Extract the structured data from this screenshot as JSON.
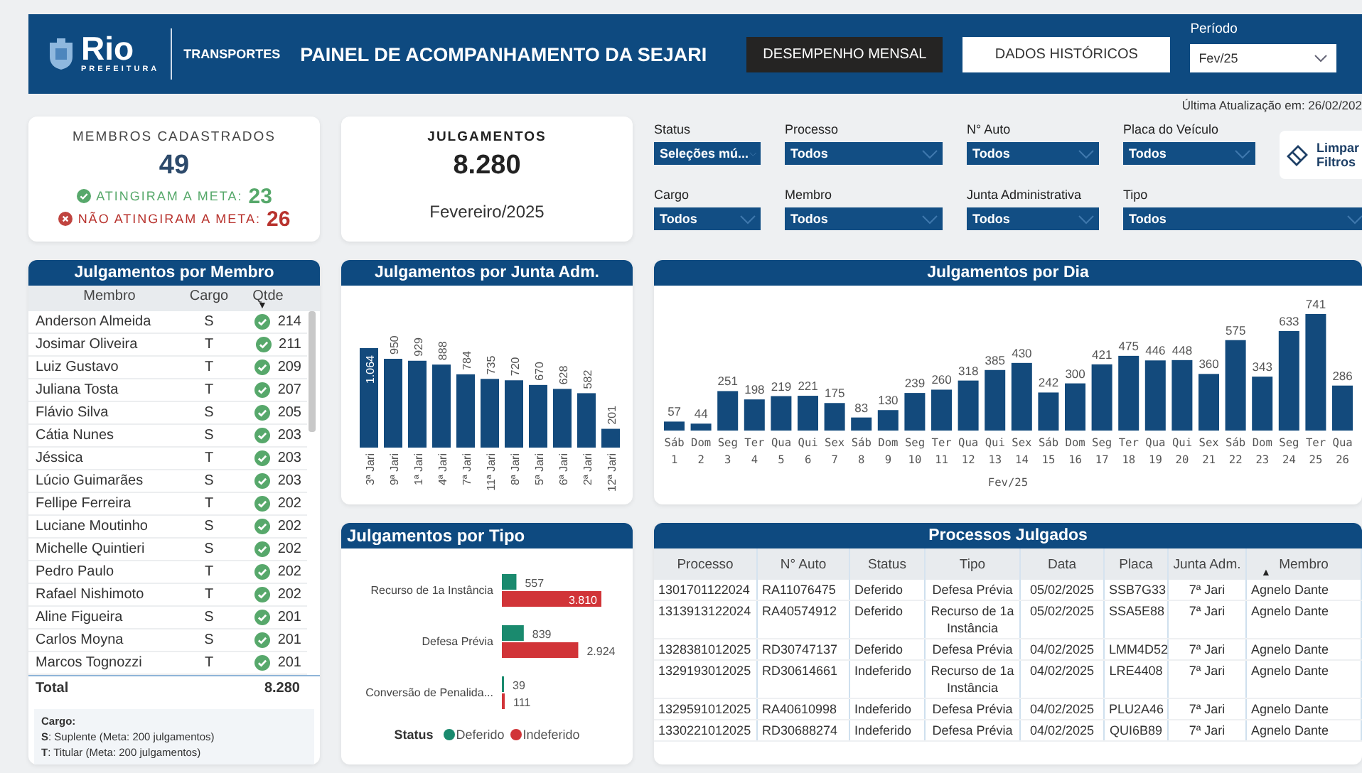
{
  "header": {
    "logo_text": "Rio",
    "logo_subtext": "PREFEITURA",
    "section": "TRANSPORTES",
    "title": "PAINEL DE ACOMPANHAMENTO DA SEJARI",
    "tabs": [
      {
        "label": "DESEMPENHO MENSAL",
        "selected": true
      },
      {
        "label": "DADOS HISTÓRICOS",
        "selected": false
      }
    ],
    "period": {
      "label": "Período",
      "value": "Fev/25"
    }
  },
  "last_update": "Última Atualização em: 26/02/202",
  "members_card": {
    "title": "MEMBROS CADASTRADOS",
    "value": "49",
    "met_label": "ATINGIRAM A META:",
    "met_value": "23",
    "not_met_label": "NÃO ATINGIRAM A META:",
    "not_met_value": "26"
  },
  "judgments_card": {
    "title": "JULGAMENTOS",
    "value": "8.280",
    "period": "Fevereiro/2025"
  },
  "filters": [
    {
      "label": "Status",
      "value": "Seleções mú..."
    },
    {
      "label": "Processo",
      "value": "Todos"
    },
    {
      "label": "N° Auto",
      "value": "Todos"
    },
    {
      "label": "Placa do Veículo",
      "value": "Todos"
    },
    {
      "label": "Cargo",
      "value": "Todos"
    },
    {
      "label": "Membro",
      "value": "Todos"
    },
    {
      "label": "Junta Administrativa",
      "value": "Todos"
    },
    {
      "label": "Tipo",
      "value": "Todos"
    }
  ],
  "clear_filters": "Limpar Filtros",
  "members_table": {
    "title": "Julgamentos por Membro",
    "columns": [
      {
        "label": "Membro"
      },
      {
        "label": "Cargo"
      },
      {
        "label": "Qtde",
        "sort_icon": "▼"
      }
    ],
    "rows": [
      {
        "name": "Anderson Almeida",
        "cargo": "S",
        "qtde": "214",
        "met": true
      },
      {
        "name": "Josimar Oliveira",
        "cargo": "T",
        "qtde": "211",
        "met": true
      },
      {
        "name": "Luiz Gustavo",
        "cargo": "T",
        "qtde": "209",
        "met": true
      },
      {
        "name": "Juliana Tosta",
        "cargo": "T",
        "qtde": "207",
        "met": true
      },
      {
        "name": "Flávio Silva",
        "cargo": "S",
        "qtde": "205",
        "met": true
      },
      {
        "name": "Cátia Nunes",
        "cargo": "S",
        "qtde": "203",
        "met": true
      },
      {
        "name": "Jéssica",
        "cargo": "T",
        "qtde": "203",
        "met": true
      },
      {
        "name": "Lúcio Guimarães",
        "cargo": "S",
        "qtde": "203",
        "met": true
      },
      {
        "name": "Fellipe Ferreira",
        "cargo": "T",
        "qtde": "202",
        "met": true
      },
      {
        "name": "Luciane Moutinho",
        "cargo": "S",
        "qtde": "202",
        "met": true
      },
      {
        "name": "Michelle Quintieri",
        "cargo": "S",
        "qtde": "202",
        "met": true
      },
      {
        "name": "Pedro Paulo",
        "cargo": "T",
        "qtde": "202",
        "met": true
      },
      {
        "name": "Rafael Nishimoto",
        "cargo": "T",
        "qtde": "202",
        "met": true
      },
      {
        "name": "Aline Figueira",
        "cargo": "S",
        "qtde": "201",
        "met": true
      },
      {
        "name": "Carlos Moyna",
        "cargo": "S",
        "qtde": "201",
        "met": true
      },
      {
        "name": "Marcos Tognozzi",
        "cargo": "T",
        "qtde": "201",
        "met": true
      }
    ],
    "total_label": "Total",
    "total": "8.280",
    "legend": {
      "title": "Cargo:",
      "items": [
        "**S**: Suplente (Meta: 200 julgamentos)",
        "**T**: Titular (Meta: 200 julgamentos)"
      ]
    }
  },
  "junta_chart": {
    "title": "Julgamentos por Junta Adm.",
    "chart_data": {
      "type": "bar",
      "categories": [
        "3ª Jari",
        "9ª Jari",
        "1ª Jari",
        "4ª Jari",
        "7ª Jari",
        "11ª Jari",
        "8ª Jari",
        "5ª Jari",
        "6ª Jari",
        "2ª Jari",
        "12ª Jari"
      ],
      "values": [
        1064,
        950,
        929,
        888,
        784,
        735,
        720,
        670,
        628,
        582,
        201
      ],
      "data_labels": true,
      "value_labels": [
        "1.064",
        "950",
        "929",
        "888",
        "784",
        "735",
        "720",
        "670",
        "628",
        "582",
        "201"
      ]
    }
  },
  "day_chart": {
    "title": "Julgamentos por Dia",
    "chart_data": {
      "type": "bar",
      "xlabel": "Fev/25",
      "categories": [
        "Sáb 1",
        "Dom 2",
        "Seg 3",
        "Ter 4",
        "Qua 5",
        "Qui 6",
        "Sex 7",
        "Sáb 8",
        "Dom 9",
        "Seg 10",
        "Ter 11",
        "Qua 12",
        "Qui 13",
        "Sex 14",
        "Sáb 15",
        "Dom 16",
        "Seg 17",
        "Ter 18",
        "Qua 19",
        "Qui 20",
        "Sex 21",
        "Sáb 22",
        "Dom 23",
        "Seg 24",
        "Ter 25",
        "Qua 26"
      ],
      "values": [
        57,
        44,
        251,
        198,
        219,
        221,
        175,
        83,
        130,
        239,
        260,
        318,
        385,
        430,
        242,
        300,
        421,
        475,
        446,
        448,
        360,
        575,
        343,
        633,
        741,
        286
      ],
      "data_labels": true
    }
  },
  "tipo_chart": {
    "title": "Julgamentos por Tipo",
    "chart_data": {
      "type": "bar",
      "orientation": "horizontal",
      "categories": [
        "Recurso de 1a Instância",
        "Defesa Prévia",
        "Conversão de Penalida..."
      ],
      "series": [
        {
          "name": "Deferido",
          "color": "#1a8a6e",
          "values": [
            557,
            839,
            39
          ],
          "value_labels": [
            "557",
            "839",
            "39"
          ]
        },
        {
          "name": "Indeferido",
          "color": "#d13438",
          "values": [
            3810,
            2924,
            111
          ],
          "value_labels": [
            "3.810",
            "2.924",
            "111"
          ]
        }
      ],
      "data_labels": true,
      "legend": {
        "title": "Status"
      }
    }
  },
  "processes_table": {
    "title": "Processos Julgados",
    "columns": [
      {
        "label": "Processo"
      },
      {
        "label": "N° Auto"
      },
      {
        "label": "Status"
      },
      {
        "label": "Tipo"
      },
      {
        "label": "Data"
      },
      {
        "label": "Placa"
      },
      {
        "label": "Junta Adm."
      },
      {
        "label": "Membro",
        "sort_icon": "▲"
      }
    ],
    "rows": [
      [
        "1301701122024",
        "RA11076475",
        "Deferido",
        "Defesa Prévia",
        "05/02/2025",
        "SSB7G33",
        "7ª Jari",
        "Agnelo Dante"
      ],
      [
        "1313913122024",
        "RA40574912",
        "Deferido",
        "Recurso de 1a Instância",
        "05/02/2025",
        "SSA5E88",
        "7ª Jari",
        "Agnelo Dante"
      ],
      [
        "1328381012025",
        "RD30747137",
        "Deferido",
        "Defesa Prévia",
        "04/02/2025",
        "LMM4D52",
        "7ª Jari",
        "Agnelo Dante"
      ],
      [
        "1329193012025",
        "RD30614661",
        "Indeferido",
        "Recurso de 1a Instância",
        "04/02/2025",
        "LRE4408",
        "7ª Jari",
        "Agnelo Dante"
      ],
      [
        "1329591012025",
        "RA40610998",
        "Indeferido",
        "Defesa Prévia",
        "04/02/2025",
        "PLU2A46",
        "7ª Jari",
        "Agnelo Dante"
      ],
      [
        "1330221012025",
        "RD30688274",
        "Indeferido",
        "Defesa Prévia",
        "04/02/2025",
        "QUI6B89",
        "7ª Jari",
        "Agnelo Dante"
      ]
    ]
  }
}
